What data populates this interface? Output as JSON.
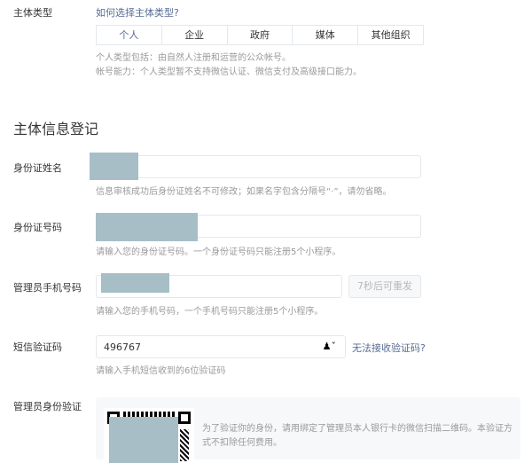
{
  "entity_type": {
    "label": "主体类型",
    "help_link": "如何选择主体类型?",
    "options": [
      "个人",
      "企业",
      "政府",
      "媒体",
      "其他组织"
    ],
    "selected": "个人",
    "tips": [
      "个人类型包括：由自然人注册和运营的公众帐号。",
      "帐号能力：个人类型暂不支持微信认证、微信支付及高级接口能力。"
    ]
  },
  "section_title": "主体信息登记",
  "id_name": {
    "label": "身份证姓名",
    "value": "",
    "tip": "信息审核成功后身份证姓名不可修改；如果名字包含分隔号“·”，请勿省略。"
  },
  "id_number": {
    "label": "身份证号码",
    "value": "",
    "tip": "请输入您的身份证号码。一个身份证号码只能注册5个小程序。"
  },
  "phone": {
    "label": "管理员手机号码",
    "value": "",
    "resend_button": "7秒后可重发",
    "tip": "请输入您的手机号码，一个手机号码只能注册5个小程序。"
  },
  "sms": {
    "label": "短信验证码",
    "value": "496767",
    "help_link": "无法接收验证码?",
    "tip": "请输入手机短信收到的6位验证码",
    "icon": "user-dropdown-icon"
  },
  "admin_verify": {
    "label": "管理员身份验证",
    "desc": "为了验证你的身份，请用绑定了管理员本人银行卡的微信扫描二维码。本验证方式不扣除任何费用。"
  },
  "colors": {
    "link": "#576b95",
    "redaction": "#a7bec7"
  }
}
